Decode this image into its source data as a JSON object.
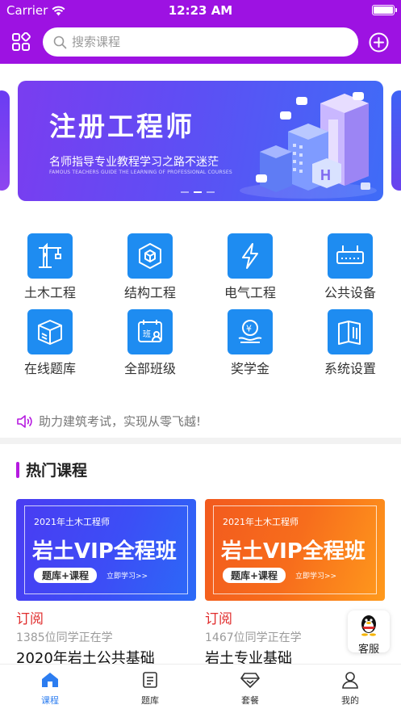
{
  "status_bar": {
    "carrier": "Carrier",
    "time": "12:23 AM"
  },
  "search": {
    "placeholder": "搜索课程"
  },
  "banner": {
    "title": "注册工程师",
    "subtitle": "名师指导专业教程学习之路不迷茫",
    "subtitle_en": "FAMOUS TEACHERS GUIDE THE LEARNING OF PROFESSIONAL COURSES"
  },
  "categories": [
    {
      "label": "土木工程",
      "icon": "crane-icon"
    },
    {
      "label": "结构工程",
      "icon": "cube-icon"
    },
    {
      "label": "电气工程",
      "icon": "lightning-icon"
    },
    {
      "label": "公共设备",
      "icon": "router-icon"
    },
    {
      "label": "在线题库",
      "icon": "box-icon"
    },
    {
      "label": "全部班级",
      "icon": "class-icon"
    },
    {
      "label": "奖学金",
      "icon": "scholarship-icon"
    },
    {
      "label": "系统设置",
      "icon": "book-icon"
    }
  ],
  "notice": {
    "text": "助力建筑考试，实现从零飞越!"
  },
  "section": {
    "title": "热门课程"
  },
  "courses": [
    {
      "year": "2021年土木工程师",
      "headline": "岩土VIP全程班",
      "tag": "题库+课程",
      "cta": "立即学习>>",
      "subscribe": "订阅",
      "count": "1385位同学正在学",
      "name": "2020年岩土公共基础",
      "color_from": "#4a3cf2",
      "color_to": "#2b5cf7"
    },
    {
      "year": "2021年土木工程师",
      "headline": "岩土VIP全程班",
      "tag": "题库+课程",
      "cta": "立即学习>>",
      "subscribe": "订阅",
      "count": "1467位同学正在学",
      "name": "岩土专业基础",
      "color_from": "#f25a1e",
      "color_to": "#ff9a1c"
    }
  ],
  "kefu": {
    "label": "客服"
  },
  "tabs": [
    {
      "label": "课程",
      "icon": "home-icon",
      "active": true
    },
    {
      "label": "题库",
      "icon": "document-icon",
      "active": false
    },
    {
      "label": "套餐",
      "icon": "diamond-icon",
      "active": false
    },
    {
      "label": "我的",
      "icon": "user-icon",
      "active": false
    }
  ],
  "colors": {
    "header": "#9d12e2",
    "category_icon_bg": "#1e8cf1",
    "accent_tab": "#2c7df0",
    "subscribe": "#e02c2c"
  }
}
